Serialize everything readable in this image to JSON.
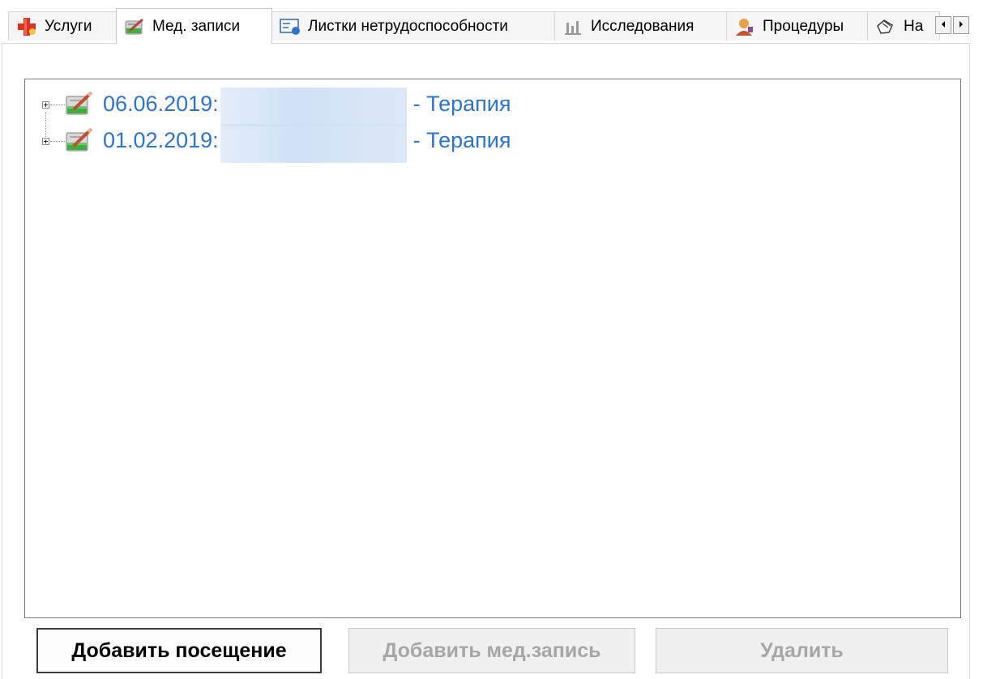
{
  "tabs": [
    {
      "label": "Услуги",
      "icon": "medical-cross-icon",
      "active": false
    },
    {
      "label": "Мед. записи",
      "icon": "medical-record-icon",
      "active": true
    },
    {
      "label": "Листки нетрудоспособности",
      "icon": "sick-leave-icon",
      "active": false
    },
    {
      "label": "Исследования",
      "icon": "research-chart-icon",
      "active": false
    },
    {
      "label": "Процедуры",
      "icon": "procedure-person-icon",
      "active": false
    },
    {
      "label": "На",
      "icon": "referral-hand-icon",
      "active": false
    }
  ],
  "tab_scroll": {
    "left_icon": "scroll-left-icon",
    "right_icon": "scroll-right-icon"
  },
  "tree": {
    "records": [
      {
        "date": "06.06.2019:",
        "suffix": "- Терапия",
        "icon": "medical-record-icon"
      },
      {
        "date": "01.02.2019:",
        "suffix": "- Терапия",
        "icon": "medical-record-icon"
      }
    ]
  },
  "buttons": {
    "add_visit": "Добавить посещение",
    "add_record": "Добавить мед.запись",
    "delete": "Удалить"
  },
  "colors": {
    "link_text": "#2b74d4",
    "disabled_text": "#a6a6a6",
    "tree_border": "#7a7a7a"
  }
}
